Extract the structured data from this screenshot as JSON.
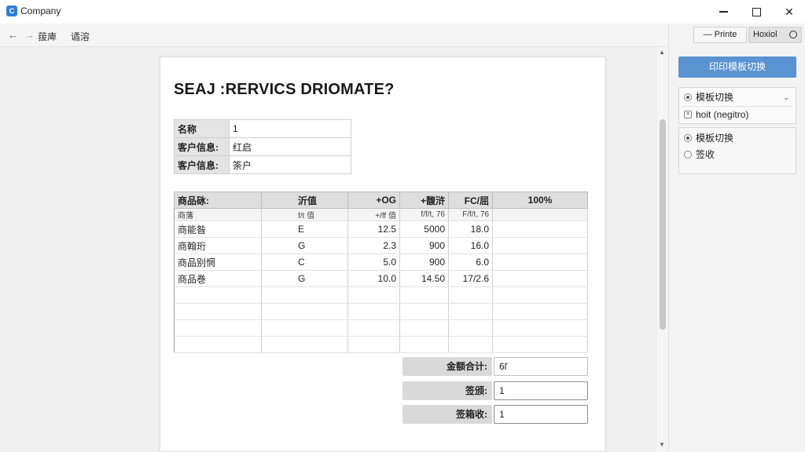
{
  "window": {
    "title": "Company",
    "icon_letter": "C"
  },
  "toolbar": {
    "back_icon": "←",
    "forward_icon": "→",
    "menu_1": "菝庳",
    "menu_2": "谲溶"
  },
  "document": {
    "title": "SEAJ :RERVICS DRIOMATE?",
    "info": [
      {
        "label": "名称",
        "value": "1"
      },
      {
        "label": "客户信息:",
        "value": "红启"
      },
      {
        "label": "客户信息:",
        "value": "筡户"
      }
    ],
    "items_header": [
      "商品砯:",
      "沂值",
      "+OG",
      "+馥浒",
      "FC/屈",
      "100%"
    ],
    "items_subheader": [
      "商藩",
      "f/t 值",
      "+/ff 值",
      "f/f/t, 76",
      "F/f/t, 76",
      ""
    ],
    "items_rows": [
      [
        "商能昝",
        "E",
        "12.5",
        "5000",
        "18.0",
        ""
      ],
      [
        "商翰珩",
        "G",
        "2.3",
        "900",
        "16.0",
        ""
      ],
      [
        "商品别惘",
        "C",
        "5.0",
        "900",
        "6.0",
        ""
      ],
      [
        "商品巻",
        "G",
        "10.0",
        "14.50",
        "17/2.6",
        ""
      ],
      [
        "",
        "",
        "",
        "",
        "",
        ""
      ],
      [
        "",
        "",
        "",
        "",
        "",
        ""
      ],
      [
        "",
        "",
        "",
        "",
        "",
        ""
      ],
      [
        "",
        "",
        "",
        "",
        "",
        ""
      ]
    ],
    "totals": [
      {
        "label": "金额合计:",
        "value": "6ľ"
      },
      {
        "label": "签颁:",
        "value": "1"
      },
      {
        "label": "签箱收:",
        "value": "1"
      }
    ]
  },
  "right_panel": {
    "print_label": "Printe",
    "mode_label": "Hoxiol",
    "primary_button": "印印模板切换",
    "group1": {
      "item1": "模板切换",
      "item2": "hoit (negitro)"
    },
    "group2": {
      "item1": "模板切换",
      "item2": "签收"
    }
  }
}
